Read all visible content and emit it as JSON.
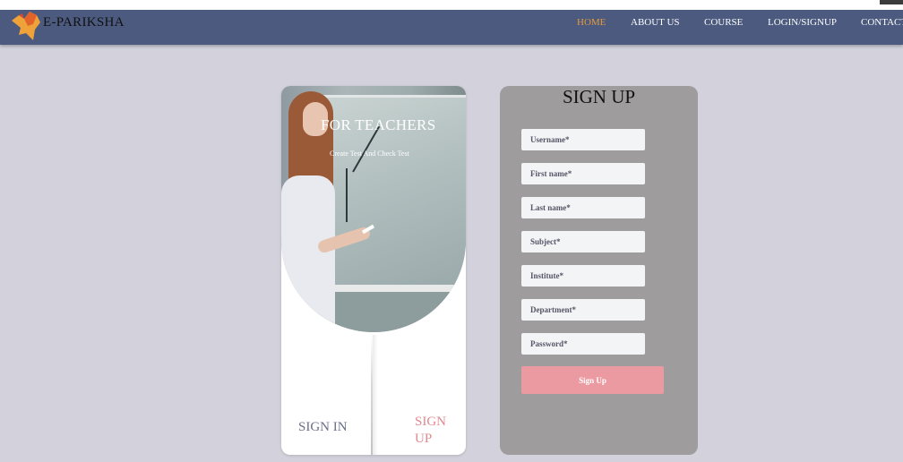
{
  "brand": {
    "name": "E-PARIKSHA",
    "logo_icon": "map-logo-icon"
  },
  "nav": {
    "items": [
      {
        "label": "HOME",
        "active": true
      },
      {
        "label": "ABOUT US",
        "active": false
      },
      {
        "label": "COURSE",
        "active": false
      },
      {
        "label": "LOGIN/SIGNUP",
        "active": false
      },
      {
        "label": "CONTACT",
        "active": false
      }
    ]
  },
  "left_card": {
    "title": "FOR TEACHERS",
    "subtitle": "Create Test And Check Test",
    "tab_signin": "SIGN IN",
    "tab_signup": "SIGN UP"
  },
  "form": {
    "title": "SIGN UP",
    "fields": [
      {
        "placeholder": "Username*"
      },
      {
        "placeholder": "First name*"
      },
      {
        "placeholder": "Last name*"
      },
      {
        "placeholder": "Subject*"
      },
      {
        "placeholder": "Institute*"
      },
      {
        "placeholder": "Department*"
      },
      {
        "placeholder": "Password*"
      }
    ],
    "submit_label": "Sign Up"
  },
  "colors": {
    "navbar": "#4b5a7e",
    "active_nav": "#e39a3c",
    "background": "#d3d2dc",
    "form_card": "#9e9c9d",
    "submit": "#ec9aa1",
    "signup_tab": "#e08a8f"
  }
}
